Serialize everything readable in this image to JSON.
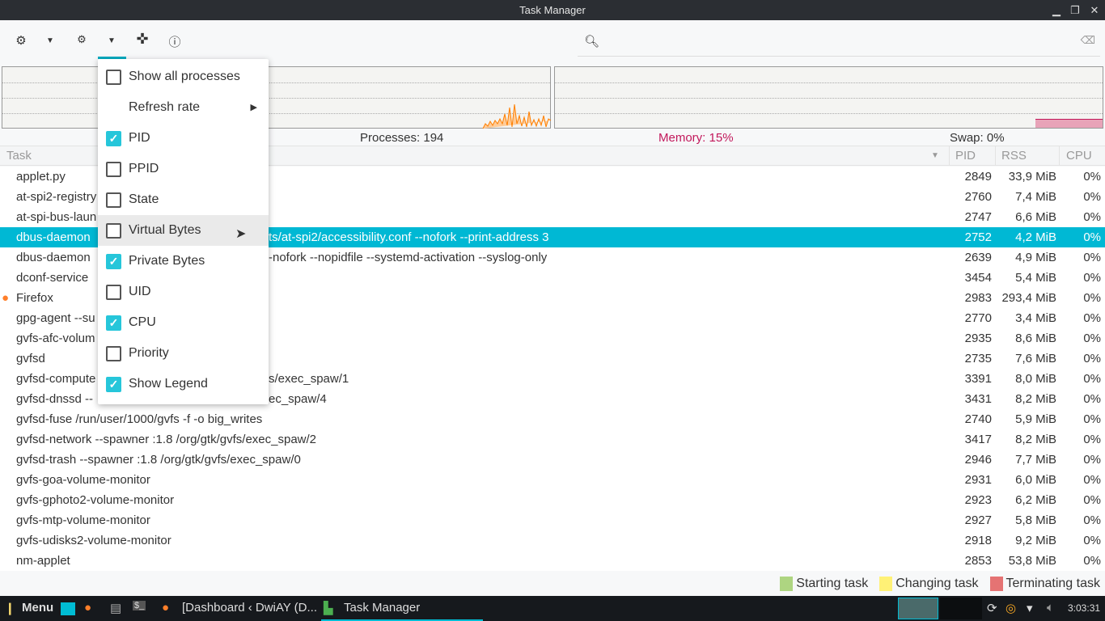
{
  "window": {
    "title": "Task Manager"
  },
  "toolbar": {
    "icons": [
      "gear-icon",
      "chevron-down-icon",
      "gears-icon",
      "chevron-down-icon",
      "crosshair-icon",
      "info-icon"
    ],
    "search_placeholder": ""
  },
  "stats": {
    "processes": "Processes: 194",
    "memory": "Memory: 15%",
    "swap": "Swap: 0%",
    "memory_color": "#c2185b"
  },
  "columns": {
    "task": "Task",
    "pid": "PID",
    "rss": "RSS",
    "cpu": "CPU"
  },
  "rows": [
    {
      "task": "applet.py",
      "tail": "",
      "pid": "2849",
      "rss": "33,9 MiB",
      "cpu": "0%"
    },
    {
      "task": "at-spi2-registry",
      "tail": "",
      "pid": "2760",
      "rss": "7,4 MiB",
      "cpu": "0%"
    },
    {
      "task": "at-spi-bus-laun",
      "tail": "",
      "pid": "2747",
      "rss": "6,6 MiB",
      "cpu": "0%"
    },
    {
      "task": "dbus-daemon",
      "tail": "ts/at-spi2/accessibility.conf --nofork --print-address 3",
      "pid": "2752",
      "rss": "4,2 MiB",
      "cpu": "0%",
      "selected": true
    },
    {
      "task": "dbus-daemon",
      "tail": "-nofork --nopidfile --systemd-activation --syslog-only",
      "pid": "2639",
      "rss": "4,9 MiB",
      "cpu": "0%"
    },
    {
      "task": "dconf-service",
      "tail": "",
      "pid": "3454",
      "rss": "5,4 MiB",
      "cpu": "0%"
    },
    {
      "task": "Firefox",
      "tail": "",
      "pid": "2983",
      "rss": "293,4 MiB",
      "cpu": "0%",
      "icon": "firefox-icon"
    },
    {
      "task": "gpg-agent --su",
      "tail": "",
      "pid": "2770",
      "rss": "3,4 MiB",
      "cpu": "0%"
    },
    {
      "task": "gvfs-afc-volum",
      "tail": "",
      "pid": "2935",
      "rss": "8,6 MiB",
      "cpu": "0%"
    },
    {
      "task": "gvfsd",
      "tail": "",
      "pid": "2735",
      "rss": "7,6 MiB",
      "cpu": "0%"
    },
    {
      "task": "gvfsd-compute",
      "tail": "s/exec_spaw/1",
      "pid": "3391",
      "rss": "8,0 MiB",
      "cpu": "0%"
    },
    {
      "task": "gvfsd-dnssd --",
      "tail": "ec_spaw/4",
      "pid": "3431",
      "rss": "8,2 MiB",
      "cpu": "0%"
    },
    {
      "task": "gvfsd-fuse /run/user/1000/gvfs -f -o big_writes",
      "tail": "",
      "pid": "2740",
      "rss": "5,9 MiB",
      "cpu": "0%"
    },
    {
      "task": "gvfsd-network --spawner :1.8 /org/gtk/gvfs/exec_spaw/2",
      "tail": "",
      "pid": "3417",
      "rss": "8,2 MiB",
      "cpu": "0%"
    },
    {
      "task": "gvfsd-trash --spawner :1.8 /org/gtk/gvfs/exec_spaw/0",
      "tail": "",
      "pid": "2946",
      "rss": "7,7 MiB",
      "cpu": "0%"
    },
    {
      "task": "gvfs-goa-volume-monitor",
      "tail": "",
      "pid": "2931",
      "rss": "6,0 MiB",
      "cpu": "0%"
    },
    {
      "task": "gvfs-gphoto2-volume-monitor",
      "tail": "",
      "pid": "2923",
      "rss": "6,2 MiB",
      "cpu": "0%"
    },
    {
      "task": "gvfs-mtp-volume-monitor",
      "tail": "",
      "pid": "2927",
      "rss": "5,8 MiB",
      "cpu": "0%"
    },
    {
      "task": "gvfs-udisks2-volume-monitor",
      "tail": "",
      "pid": "2918",
      "rss": "9,2 MiB",
      "cpu": "0%"
    },
    {
      "task": "nm-applet",
      "tail": "",
      "pid": "2853",
      "rss": "53,8 MiB",
      "cpu": "0%"
    }
  ],
  "legend": [
    {
      "label": "Starting task",
      "color": "#aed581"
    },
    {
      "label": "Changing task",
      "color": "#fff176"
    },
    {
      "label": "Terminating task",
      "color": "#e57373"
    }
  ],
  "menu": [
    {
      "label": "Show all processes",
      "checkbox": true,
      "checked": false
    },
    {
      "label": "Refresh rate",
      "checkbox": false,
      "submenu": true
    },
    {
      "label": "PID",
      "checkbox": true,
      "checked": true
    },
    {
      "label": "PPID",
      "checkbox": true,
      "checked": false
    },
    {
      "label": "State",
      "checkbox": true,
      "checked": false
    },
    {
      "label": "Virtual Bytes",
      "checkbox": true,
      "checked": false,
      "hover": true
    },
    {
      "label": "Private Bytes",
      "checkbox": true,
      "checked": true
    },
    {
      "label": "UID",
      "checkbox": true,
      "checked": false
    },
    {
      "label": "CPU",
      "checkbox": true,
      "checked": true
    },
    {
      "label": "Priority",
      "checkbox": true,
      "checked": false
    },
    {
      "label": "Show Legend",
      "checkbox": true,
      "checked": true
    }
  ],
  "taskbar": {
    "menu": "Menu",
    "window1": "[Dashboard ‹ DwiAY (D...",
    "window2": "Task Manager",
    "clock": "3:03:31"
  }
}
